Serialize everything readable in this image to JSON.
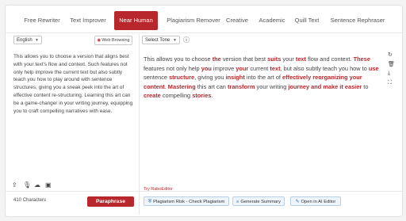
{
  "tabs": [
    {
      "label": "Free Rewriter",
      "active": false
    },
    {
      "label": "Text Improver",
      "active": false
    },
    {
      "label": "Near Human",
      "active": true
    },
    {
      "label": "Plagiarism Remover",
      "active": false
    },
    {
      "label": "Creative",
      "active": false
    },
    {
      "label": "Academic",
      "active": false
    },
    {
      "label": "Quill Text",
      "active": false
    },
    {
      "label": "Sentence Rephraser",
      "active": false
    }
  ],
  "input_panel": {
    "language": "English",
    "web_browsing_label": "Web Browsing",
    "text": "This allows you to choose a version that aligns best with your text's flow and context. Such features not only help improve the current text but also subtly teach you how to play around with sentence structures, giving you a sneak peek into the art of effective content re-structuring. Learning this art can be a game-changer in your writing journey, equipping you to craft compelling narratives with ease.",
    "char_count": "410 Characters",
    "paraphrase_label": "Paraphrase"
  },
  "output_panel": {
    "tone_placeholder": "Select Tone",
    "segments": [
      {
        "t": "This allows you to choose ",
        "h": false
      },
      {
        "t": "the",
        "h": true
      },
      {
        "t": " version that best ",
        "h": false
      },
      {
        "t": "suits",
        "h": true
      },
      {
        "t": " your ",
        "h": false
      },
      {
        "t": "text",
        "h": true
      },
      {
        "t": " flow and context. ",
        "h": false
      },
      {
        "t": "These",
        "h": true
      },
      {
        "t": " features not only help ",
        "h": false
      },
      {
        "t": "you",
        "h": true
      },
      {
        "t": " improve ",
        "h": false
      },
      {
        "t": "your",
        "h": true
      },
      {
        "t": " current ",
        "h": false
      },
      {
        "t": "text",
        "h": true
      },
      {
        "t": ", but also subtly teach you how to ",
        "h": false
      },
      {
        "t": "use",
        "h": true
      },
      {
        "t": " sentence ",
        "h": false
      },
      {
        "t": "structure",
        "h": true
      },
      {
        "t": ", giving you ",
        "h": false
      },
      {
        "t": "insight",
        "h": true
      },
      {
        "t": " into the art of ",
        "h": false
      },
      {
        "t": "effectively reorganizing your content",
        "h": true
      },
      {
        "t": ". ",
        "h": false
      },
      {
        "t": "Mastering",
        "h": true
      },
      {
        "t": " this art can ",
        "h": false
      },
      {
        "t": "transform",
        "h": true
      },
      {
        "t": " your writing ",
        "h": false
      },
      {
        "t": "journey and make it easier",
        "h": true
      },
      {
        "t": " to ",
        "h": false
      },
      {
        "t": "create",
        "h": true
      },
      {
        "t": " compelling ",
        "h": false
      },
      {
        "t": "stories",
        "h": true
      },
      {
        "t": ".",
        "h": false
      }
    ],
    "try_link": "Try RaboEditor",
    "buttons": {
      "plagiarism": "Plagiarism Risk - Check Plagiarism",
      "summary": "Generate Summary",
      "ai_editor": "Open in AI Editor"
    }
  },
  "icons": {
    "input_tools": [
      "upload-icon",
      "microphone-icon",
      "cloud-icon",
      "image-icon"
    ],
    "output_tools": [
      "refresh-icon",
      "trash-icon",
      "download-icon",
      "expand-icon"
    ]
  },
  "colors": {
    "accent": "#b7272c",
    "secondary_button_bg": "#eef4fb"
  }
}
